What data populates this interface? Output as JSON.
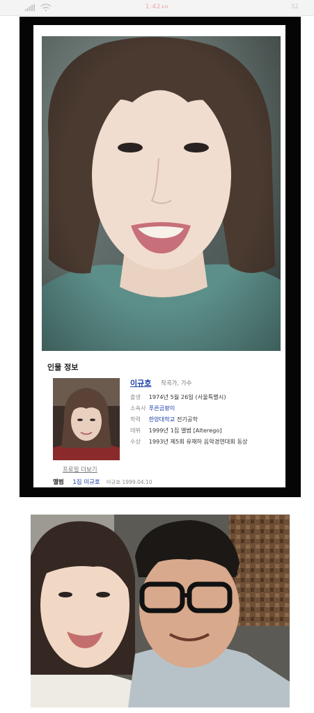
{
  "status_bar": {
    "time": "1:42",
    "time_suffix": "AM",
    "battery": "32"
  },
  "profile_card": {
    "section_title": "인물 정보",
    "name": "이규호",
    "role": "작곡가, 가수",
    "rows": [
      {
        "key": "출생",
        "value": "1974년 5월 26일 (서울특별시)"
      },
      {
        "key": "소속사",
        "value": "푸른곰팡이"
      },
      {
        "key": "학력",
        "value": "한양대학교",
        "extra": "전기공학"
      },
      {
        "key": "데뷔",
        "value": "1999년 1집 앨범 [Alterego]"
      },
      {
        "key": "수상",
        "value": "1993년 제5회 유재하 음악경연대회 동상"
      }
    ],
    "more_link": "프로필 더보기",
    "album_label": "앨범",
    "album_link": "1집 이규호",
    "album_sub": "이규호 1999.04.10"
  },
  "colors": {
    "link": "#1d40a8",
    "frame": "#050505",
    "shirt_teal": "#5d8f8a"
  }
}
